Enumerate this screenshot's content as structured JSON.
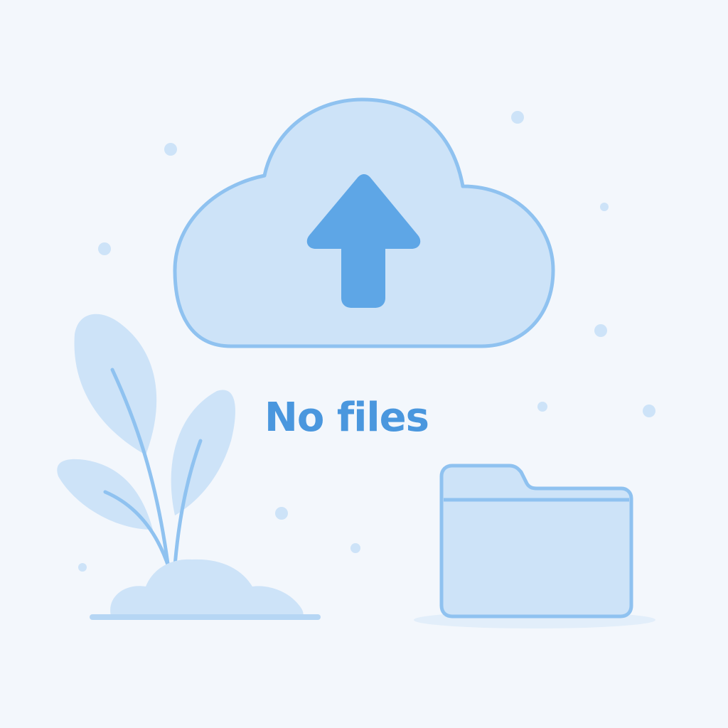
{
  "empty_state": {
    "message": "No files"
  },
  "icons": {
    "upload": "cloud-upload-icon",
    "folder": "folder-icon",
    "plant": "plant-illustration"
  },
  "colors": {
    "background": "#f3f7fc",
    "fill_light": "#cde3f8",
    "outline": "#8fc2f0",
    "accent": "#5ea6e6",
    "text": "#4a97de"
  }
}
